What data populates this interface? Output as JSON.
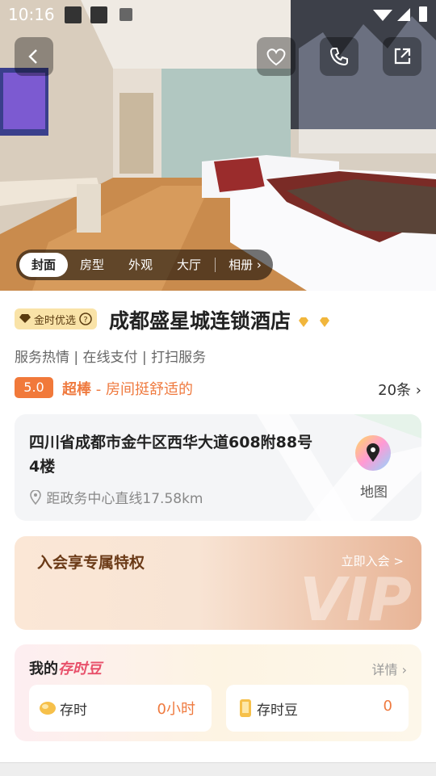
{
  "status_bar": {
    "time": "10:16"
  },
  "gallery": {
    "tabs": [
      "封面",
      "房型",
      "外观",
      "大厅"
    ],
    "album_label": "相册",
    "active_tab": "封面"
  },
  "hotel": {
    "badge": "金时优选",
    "name": "成都盛星城连锁酒店",
    "features": "服务热情 | 在线支付 | 打扫服务",
    "score": "5.0",
    "rating_word": "超棒",
    "rating_desc": "- 房间挺舒适的",
    "review_count": "20条"
  },
  "address": {
    "line": "四川省成都市金牛区西华大道608附88号4楼",
    "distance": "距政务中心直线17.58km",
    "map_label": "地图"
  },
  "vip": {
    "title": "入会享专属特权",
    "join": "立即入会 >",
    "watermark": "VIP"
  },
  "beans": {
    "title_prefix": "我的",
    "title_highlight": "存时豆",
    "detail": "详情",
    "time_label": "存时",
    "time_value": "0小时",
    "bean_label": "存时豆",
    "bean_value": "0"
  },
  "colors": {
    "accent": "#ef7a3f",
    "badge_bg": "#f9e3a8"
  }
}
